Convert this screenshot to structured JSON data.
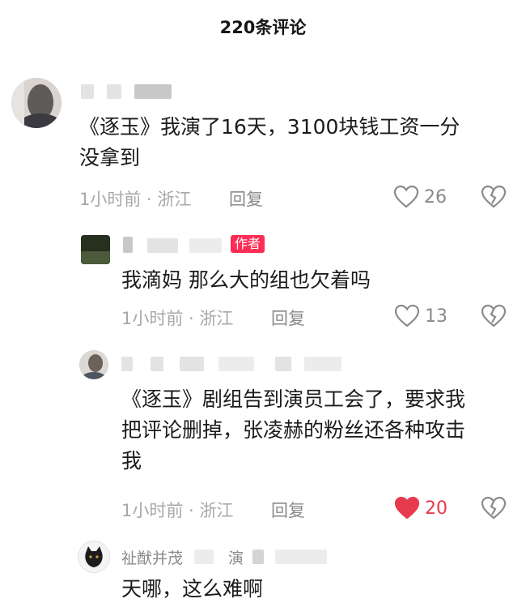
{
  "header": {
    "title": "220条评论"
  },
  "comments": [
    {
      "text_line1": "《逐玉》我演了16天，3100块钱工资一分",
      "text_line2": "没拿到",
      "meta": "1小时前 · 浙江",
      "reply": "回复",
      "likes": "26",
      "liked": false
    },
    {
      "author_tag": "作者",
      "text": "我滴妈 那么大的组也欠着吗",
      "meta": "1小时前 · 浙江",
      "reply": "回复",
      "likes": "13",
      "liked": false
    },
    {
      "text_line1": "《逐玉》剧组告到演员工会了，要求我",
      "text_line2": "把评论删掉，张凌赫的粉丝还各种攻击",
      "text_line3": "我",
      "meta": "1小时前 · 浙江",
      "reply": "回复",
      "likes": "20",
      "liked": true
    },
    {
      "name_visible": "祉猷并茂",
      "name_visible2": "演",
      "text": "天哪，这么难啊"
    }
  ],
  "colors": {
    "like_active": "#e83a4d",
    "author_tag": "#ff2c55",
    "meta": "#a8a8a8"
  },
  "icons": {
    "like": "heart-icon",
    "dislike": "broken-heart-icon"
  }
}
